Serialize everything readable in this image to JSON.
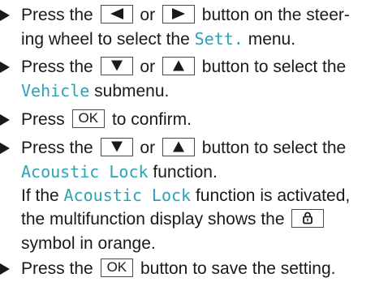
{
  "colors": {
    "display_text": "#2aa3b6",
    "text": "#1a1a1a",
    "key_border": "#4a4a4a"
  },
  "steps": [
    {
      "lines": [
        [
          "Press the",
          "or",
          "button on the steer-"
        ],
        [
          "ing wheel to select the",
          "Sett.",
          "menu."
        ]
      ],
      "keys": [
        "left-arrow-icon",
        "right-arrow-icon"
      ]
    },
    {
      "lines": [
        [
          "Press the",
          "or",
          "button to select the"
        ],
        [
          "Vehicle",
          "submenu."
        ]
      ],
      "keys": [
        "down-arrow-icon",
        "up-arrow-icon"
      ]
    },
    {
      "lines": [
        [
          "Press",
          "OK",
          "to confirm."
        ]
      ]
    },
    {
      "lines": [
        [
          "Press the",
          "or",
          "button to select the"
        ],
        [
          "Acoustic Lock",
          "function."
        ],
        [
          "If the",
          "Acoustic Lock",
          "function is activated,"
        ],
        [
          "the multifunction display shows the"
        ],
        [
          "symbol in orange."
        ]
      ],
      "keys": [
        "down-arrow-icon",
        "up-arrow-icon",
        "padlock-icon"
      ]
    },
    {
      "lines": [
        [
          "Press the",
          "OK",
          "button to save the setting."
        ]
      ]
    }
  ]
}
